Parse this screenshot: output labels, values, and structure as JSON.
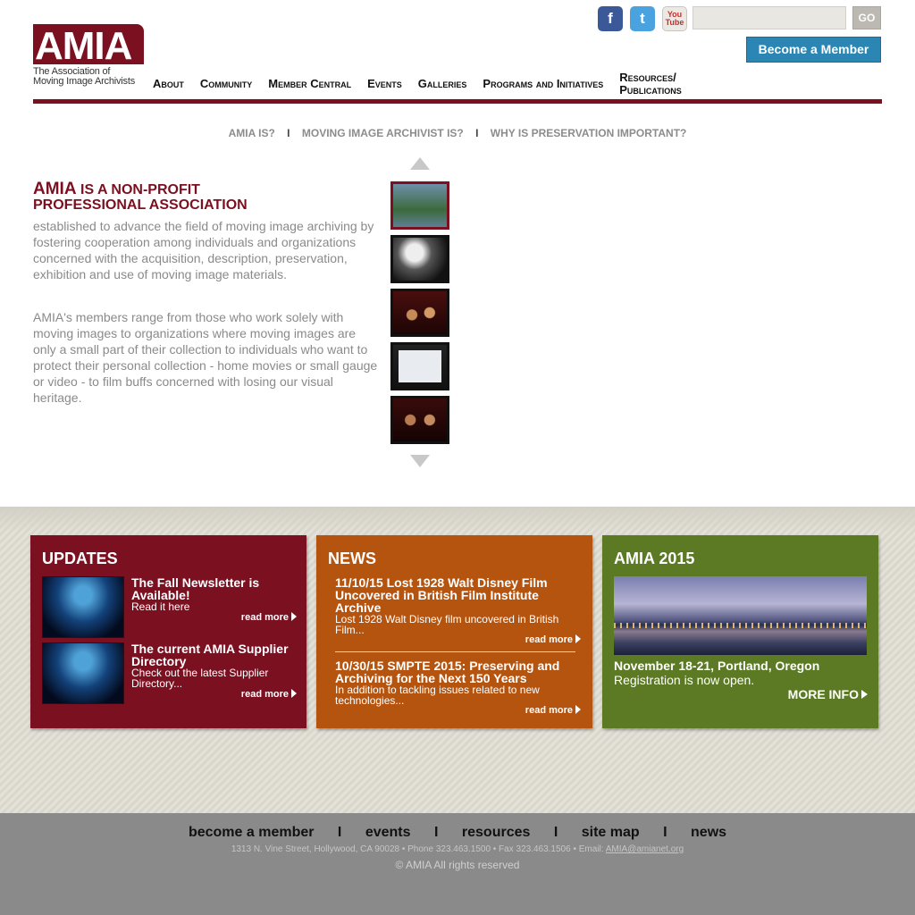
{
  "header": {
    "logo_text": "AMIA",
    "logo_tagline_1": "The Association of",
    "logo_tagline_2": "Moving Image Archivists",
    "social": {
      "facebook": "f",
      "twitter": "t",
      "youtube_1": "You",
      "youtube_2": "Tube"
    },
    "search": {
      "value": "",
      "placeholder": "",
      "go_label": "GO"
    },
    "member_button": "Become a Member"
  },
  "nav": {
    "items": [
      "About",
      "Community",
      "Member Central",
      "Events",
      "Galleries",
      "Programs and Initiatives"
    ],
    "resources_line1": "Resources/",
    "resources_line2": "Publications"
  },
  "subnav": {
    "items": [
      "AMIA IS?",
      "MOVING IMAGE ARCHIVIST IS?",
      "WHY IS PRESERVATION IMPORTANT?"
    ],
    "separator": "I"
  },
  "intro": {
    "title_big": "AMIA",
    "title_rest": " IS A NON-PROFIT",
    "title_line2": "PROFESSIONAL ASSOCIATION",
    "paragraph1": "established to advance the field of moving image archiving by fostering cooperation among individuals and organizations concerned with the acquisition, description, preservation, exhibition and use of moving image materials.",
    "paragraph2": "AMIA's members range from those who work solely with moving images to organizations where moving images are only a small part of their collection to individuals who want to protect their personal collection - home movies or small gauge or video - to film buffs concerned with losing our visual heritage."
  },
  "updates": {
    "heading": "UPDATES",
    "items": [
      {
        "title": "The Fall Newsletter is Available!",
        "desc": "Read it here",
        "readmore": "read more"
      },
      {
        "title": "The current AMIA Supplier Directory",
        "desc": "Check out the latest Supplier Directory...",
        "readmore": "read more"
      }
    ]
  },
  "news": {
    "heading": "NEWS",
    "items": [
      {
        "title": "11/10/15 Lost 1928 Walt Disney Film Uncovered in British Film Institute Archive",
        "desc": "Lost 1928 Walt Disney film uncovered in British Film...",
        "readmore": "read more"
      },
      {
        "title": "10/30/15 SMPTE 2015: Preserving and Archiving for the Next 150 Years",
        "desc": "In addition to tackling issues related to new technologies...",
        "readmore": "read more"
      }
    ]
  },
  "amia2015": {
    "heading": "AMIA 2015",
    "date_line": "November 18-21, Portland, Oregon",
    "registration": "Registration is now open.",
    "more_info": "MORE INFO"
  },
  "footer": {
    "links": [
      "become a member",
      "events",
      "resources",
      "site map",
      "news"
    ],
    "separator": "I",
    "address": "1313 N. Vine Street, Hollywood, CA 90028 • Phone 323.463.1500 • Fax 323.463.1506 • Email: ",
    "email": "AMIA@amianet.org",
    "copyright": "© AMIA All rights reserved"
  },
  "colors": {
    "brand": "#7a1020",
    "news": "#b5540f",
    "amia2015": "#5b7a23",
    "member_button": "#2b86b3"
  }
}
